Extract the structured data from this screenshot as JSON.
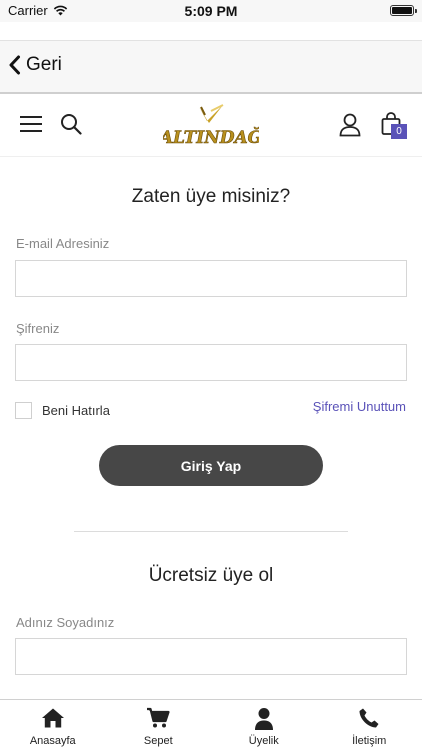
{
  "status_bar": {
    "carrier": "Carrier",
    "time": "5:09 PM"
  },
  "nav": {
    "back_label": "Geri"
  },
  "header": {
    "logo_alt": "ALTINDAĞ",
    "cart_count": "0"
  },
  "login": {
    "title": "Zaten üye misiniz?",
    "email_label": "E-mail Adresiniz",
    "email_value": "",
    "password_label": "Şifreniz",
    "password_value": "",
    "remember_label": "Beni Hatırla",
    "forgot_label": "Şifremi Unuttum",
    "submit_label": "Giriş Yap"
  },
  "register": {
    "title": "Ücretsiz üye ol",
    "name_label": "Adınız Soyadınız",
    "name_value": ""
  },
  "tabs": [
    {
      "label": "Anasayfa",
      "icon": "home-icon"
    },
    {
      "label": "Sepet",
      "icon": "cart-icon"
    },
    {
      "label": "Üyelik",
      "icon": "user-icon"
    },
    {
      "label": "İletişim",
      "icon": "phone-icon"
    }
  ],
  "colors": {
    "accent": "#5a52b8",
    "button": "#474747",
    "logo_gold": "#c9a227"
  }
}
